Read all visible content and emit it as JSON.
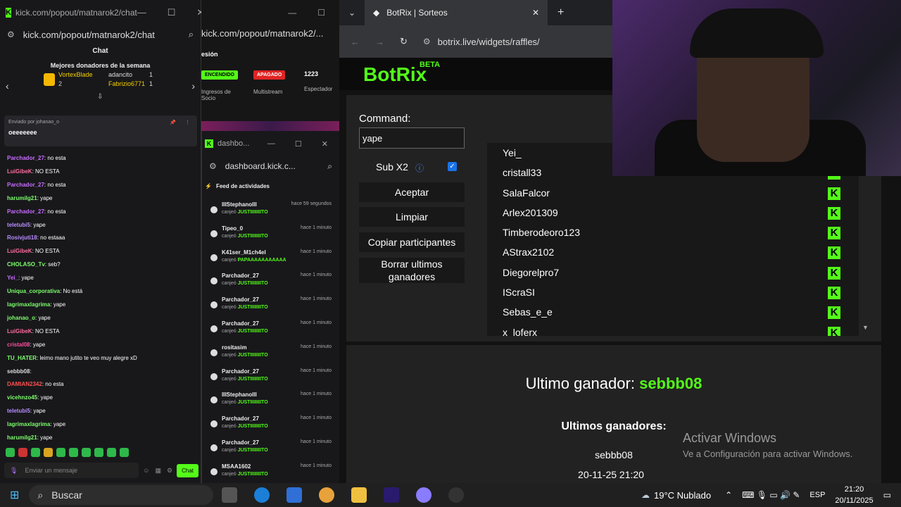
{
  "chat_window": {
    "title": "kick.com/popout/matnarok2/chat",
    "url": "kick.com/popout/matnarok2/chat",
    "header": "Chat",
    "donors_title": "Mejores donadores de la semana",
    "donors": [
      {
        "name": "VortexBlade",
        "count": "1"
      },
      {
        "name": "adancito",
        "count": "1"
      },
      {
        "name": "Fabrizio6771",
        "count": "1"
      }
    ],
    "donor_rank": "2",
    "pinned_by": "Enviado por johanao_o",
    "pinned_msg": "oeeeeeee",
    "messages": [
      {
        "user": "Parchador_27",
        "color": "#c86cff",
        "text": ": no esta"
      },
      {
        "user": "LuiGibeK",
        "color": "#ff6b9e",
        "text": ": NO ESTA"
      },
      {
        "user": "Parchador_27",
        "color": "#c86cff",
        "text": ": no esta"
      },
      {
        "user": "harumilg21",
        "color": "#7dff6b",
        "text": ": yape"
      },
      {
        "user": "Parchador_27",
        "color": "#c86cff",
        "text": ": no esta"
      },
      {
        "user": "teletubi5",
        "color": "#b88cff",
        "text": ": yape"
      },
      {
        "user": "Rosivjuti18",
        "color": "#b88cff",
        "text": ": no estaaa"
      },
      {
        "user": "LuiGibeK",
        "color": "#ff6b9e",
        "text": ": NO ESTA"
      },
      {
        "user": "CHOLASO_Tv",
        "color": "#7dff6b",
        "text": ": seb?"
      },
      {
        "user": "Yei_",
        "color": "#c86cff",
        "text": ": yape"
      },
      {
        "user": "Uniqua_corporativa",
        "color": "#7dff6b",
        "text": ": No está"
      },
      {
        "user": "lagrimaxlagrima",
        "color": "#7dff6b",
        "text": ": yape"
      },
      {
        "user": "johanao_o",
        "color": "#7dff6b",
        "text": ": yape"
      },
      {
        "user": "LuiGibeK",
        "color": "#ff6b9e",
        "text": ": NO ESTA"
      },
      {
        "user": "cristal08",
        "color": "#ff4f9e",
        "text": ": yape"
      },
      {
        "user": "TU_HATER",
        "color": "#7dff6b",
        "text": ": leimo mano jutito te veo muy alegre xD"
      },
      {
        "user": "sebbb08",
        "color": "#dddddd",
        "text": ":"
      },
      {
        "user": "DAMIAN2342",
        "color": "#ff4f4f",
        "text": ": no esta"
      },
      {
        "user": "vicehnzo45",
        "color": "#7dff6b",
        "text": ": yape"
      },
      {
        "user": "teletubi5",
        "color": "#b88cff",
        "text": ": yape"
      },
      {
        "user": "lagrimaxlagrima",
        "color": "#7dff6b",
        "text": ": yape"
      },
      {
        "user": "harumilg21",
        "color": "#7dff6b",
        "text": ": yape"
      }
    ],
    "input_placeholder": "Enviar un mensaje",
    "chat_button": "Chat"
  },
  "dash_back": {
    "url": "kick.com/popout/matnarok2/...",
    "section": "esión",
    "status_on": "ENCENDIDO",
    "status_off": "APAGADO",
    "count": "1223",
    "label_income": "Ingresos de Socio",
    "label_multistream": "Multistream",
    "label_viewers": "Espectador"
  },
  "dash": {
    "title": "dashbo...",
    "url": "dashboard.kick.c...",
    "feed_title": "Feed de actividades",
    "items": [
      {
        "user": "lIIStephanolll",
        "action": "canjeó",
        "reward": "JUSTIIIIIIIITO",
        "time": "hace 59 segundos"
      },
      {
        "user": "Tipeo_0",
        "action": "canjeó",
        "reward": "JUSTIIIIIIIITO",
        "time": "hace 1 minuto"
      },
      {
        "user": "K41ser_M1ch4el",
        "action": "canjeó",
        "reward": "PAPAAAAAAAAAAA",
        "time": "hace 1 minuto"
      },
      {
        "user": "Parchador_27",
        "action": "canjeó",
        "reward": "JUSTIIIIIIIITO",
        "time": "hace 1 minuto"
      },
      {
        "user": "Parchador_27",
        "action": "canjeó",
        "reward": "JUSTIIIIIIIITO",
        "time": "hace 1 minuto"
      },
      {
        "user": "Parchador_27",
        "action": "canjeó",
        "reward": "JUSTIIIIIIIITO",
        "time": "hace 1 minuto"
      },
      {
        "user": "rositasim",
        "action": "canjeó",
        "reward": "JUSTIIIIIIIITO",
        "time": "hace 1 minuto"
      },
      {
        "user": "Parchador_27",
        "action": "canjeó",
        "reward": "JUSTIIIIIIIITO",
        "time": "hace 1 minuto"
      },
      {
        "user": "lIIStephanolll",
        "action": "canjeó",
        "reward": "JUSTIIIIIIIITO",
        "time": "hace 1 minuto"
      },
      {
        "user": "Parchador_27",
        "action": "canjeó",
        "reward": "JUSTIIIIIIIITO",
        "time": "hace 1 minuto"
      },
      {
        "user": "Parchador_27",
        "action": "canjeó",
        "reward": "JUSTIIIIIIIITO",
        "time": "hace 1 minuto"
      },
      {
        "user": "MSAA1602",
        "action": "canjeó",
        "reward": "JUSTIIIIIIIITO",
        "time": "hace 1 minuto"
      }
    ]
  },
  "browser": {
    "tab_title": "BotRix | Sorteos",
    "url": "botrix.live/widgets/raffles/",
    "logo": "BotRix",
    "beta": "BETA",
    "command_label": "Command:",
    "command_value": "yape",
    "sub_label": "Sub X2",
    "buttons": {
      "accept": "Aceptar",
      "clear": "Limpiar",
      "copy": "Copiar participantes",
      "delete": "Borrar ultimos ganadores"
    },
    "participants": [
      "Yei_",
      "cristall33",
      "SalaFalcor",
      "Arlex201309",
      "Timberodeoro123",
      "AStrax2102",
      "Diegorelpro7",
      "IScraSI",
      "Sebas_e_e",
      "x_loferx"
    ],
    "last_winner_label": "Ultimo ganador:",
    "last_winner": "sebbb08",
    "winners_title": "Ultimos ganadores:",
    "winner_name": "sebbb08",
    "winner_date": "20-11-25 21:20",
    "activate_title": "Activar Windows",
    "activate_sub": "Ve a Configuración para activar Windows.",
    "accent": "#53fc18"
  },
  "taskbar": {
    "search": "Buscar",
    "weather": "19°C  Nublado",
    "lang": "ESP",
    "time": "21:20",
    "date": "20/11/2025"
  }
}
